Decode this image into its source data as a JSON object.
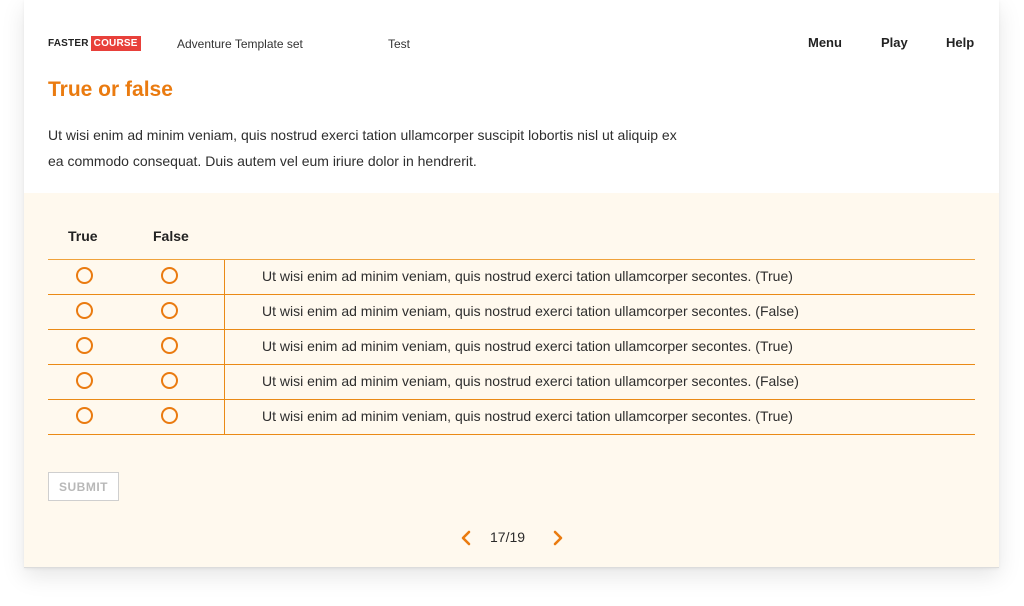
{
  "header": {
    "logo": {
      "part1": "FASTER",
      "part2": "COURSE"
    },
    "template_name": "Adventure Template set",
    "course_name": "Test",
    "menu_items": [
      "Menu",
      "Play",
      "Help"
    ]
  },
  "page": {
    "title": "True or false",
    "intro": "Ut wisi enim ad minim veniam, quis nostrud exerci tation ullamcorper suscipit lobortis nisl ut aliquip ex ea commodo consequat. Duis autem vel eum iriure dolor in hendrerit."
  },
  "quiz": {
    "col_true": "True",
    "col_false": "False",
    "statements": [
      "Ut wisi enim ad minim veniam, quis nostrud exerci tation ullamcorper secontes. (True)",
      "Ut wisi enim ad minim veniam, quis nostrud exerci tation ullamcorper secontes. (False)",
      "Ut wisi enim ad minim veniam, quis nostrud exerci tation ullamcorper secontes. (True)",
      "Ut wisi enim ad minim veniam, quis nostrud exerci tation ullamcorper secontes. (False)",
      "Ut wisi enim ad minim veniam, quis nostrud exerci tation ullamcorper secontes. (True)"
    ],
    "submit_label": "SUBMIT"
  },
  "pagination": {
    "current_total": "17/19",
    "prev_icon": "chevron-left-icon",
    "next_icon": "chevron-right-icon"
  },
  "colors": {
    "accent": "#ea7b10",
    "logo_red": "#e8403a",
    "quiz_bg": "#fff9ee"
  }
}
